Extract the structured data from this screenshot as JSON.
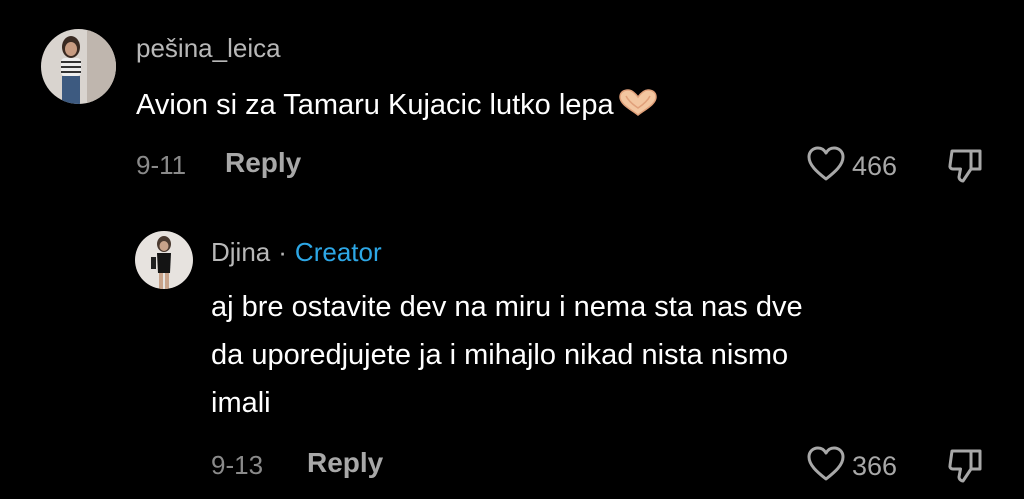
{
  "comments": [
    {
      "username": "pešina_leica",
      "text": "Avion si za Tamaru Kujacic lutko lepa",
      "emoji": "heart-hands",
      "date": "9-11",
      "reply_label": "Reply",
      "likes": "466"
    }
  ],
  "replies": [
    {
      "username": "Djina",
      "separator": "·",
      "badge": "Creator",
      "text_lines": [
        "aj bre ostavite dev na miru i nema sta nas dve",
        "da uporedjujete ja i mihajlo nikad nista nismo",
        "imali"
      ],
      "date": "9-13",
      "reply_label": "Reply",
      "likes": "366"
    }
  ],
  "colors": {
    "background": "#000000",
    "username": "#b8b8b8",
    "text": "#ffffff",
    "meta": "#8a8a8a",
    "creator_badge": "#2da7e6"
  }
}
